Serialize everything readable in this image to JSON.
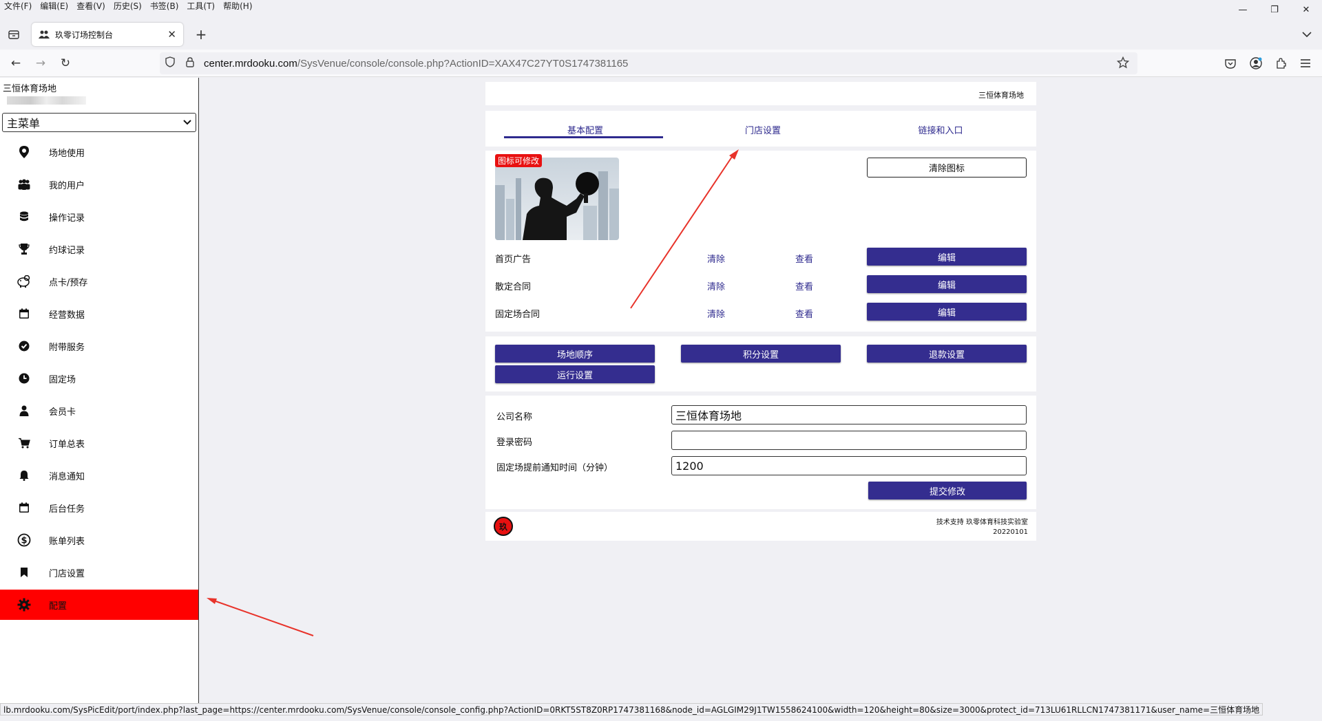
{
  "browser": {
    "menu": [
      "文件(F)",
      "编辑(E)",
      "查看(V)",
      "历史(S)",
      "书签(B)",
      "工具(T)",
      "帮助(H)"
    ],
    "tab_title": "玖零订场控制台",
    "url_domain": "center.mrdooku.com",
    "url_path": "/SysVenue/console/console.php?ActionID=XAX47C27YT0S1747381165",
    "status_url": "lb.mrdooku.com/SysPicEdit/port/index.php?last_page=https://center.mrdooku.com/SysVenue/console/console_config.php?ActionID=0RKT5ST8Z0RP1747381168&node_id=AGLGIM29J1TW1558624100&width=120&height=80&size=3000&protect_id=713LU61RLLCN1747381171&user_name=三恒体育场地"
  },
  "sidebar": {
    "venue_name": "三恒体育场地",
    "menu_select": "主菜单",
    "items": [
      {
        "label": "场地使用",
        "icon": "map-pin-icon"
      },
      {
        "label": "我的用户",
        "icon": "users-icon"
      },
      {
        "label": "操作记录",
        "icon": "database-icon"
      },
      {
        "label": "约球记录",
        "icon": "trophy-icon"
      },
      {
        "label": "点卡/预存",
        "icon": "piggy-bank-icon"
      },
      {
        "label": "经营数据",
        "icon": "calendar-icon"
      },
      {
        "label": "附带服务",
        "icon": "check-circle-icon"
      },
      {
        "label": "固定场",
        "icon": "clock-icon"
      },
      {
        "label": "会员卡",
        "icon": "user-icon"
      },
      {
        "label": "订单总表",
        "icon": "cart-icon"
      },
      {
        "label": "消息通知",
        "icon": "bell-icon"
      },
      {
        "label": "后台任务",
        "icon": "calendar-icon"
      },
      {
        "label": "账单列表",
        "icon": "dollar-circle-icon"
      },
      {
        "label": "门店设置",
        "icon": "bookmark-icon"
      },
      {
        "label": "配置",
        "icon": "gear-icon"
      }
    ],
    "active_color": "#ff0000"
  },
  "main": {
    "header_venue": "三恒体育场地",
    "tabs": [
      "基本配置",
      "门店设置",
      "链接和入口"
    ],
    "icon_tag": "图标可修改",
    "clear_icon_label": "清除图标",
    "assets": [
      {
        "name": "首页广告",
        "clear": "清除",
        "view": "查看",
        "edit": "编辑"
      },
      {
        "name": "散定合同",
        "clear": "清除",
        "view": "查看",
        "edit": "编辑"
      },
      {
        "name": "固定场合同",
        "clear": "清除",
        "view": "查看",
        "edit": "编辑"
      }
    ],
    "settings_buttons": [
      "场地顺序",
      "积分设置",
      "退款设置",
      "运行设置"
    ],
    "form": {
      "company_label": "公司名称",
      "company_value": "三恒体育场地",
      "password_label": "登录密码",
      "password_value": "",
      "notice_label": "固定场提前通知时间（分钟）",
      "notice_value": "1200",
      "submit_label": "提交修改"
    },
    "footer": {
      "logo_text": "玖",
      "support": "技术支持 玖零体育科技实验室",
      "version": "20220101"
    },
    "accent_color": "#342d8f"
  }
}
